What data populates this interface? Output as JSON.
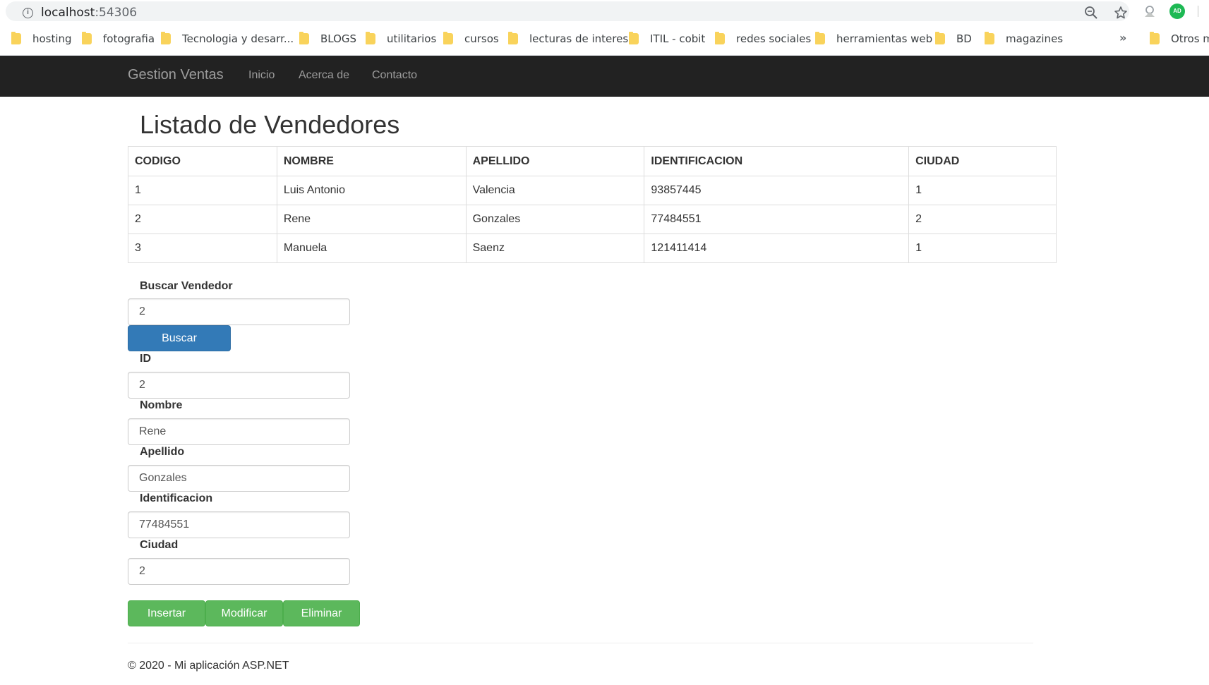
{
  "browser": {
    "url_host": "localhost",
    "url_port": ":54306",
    "avatar_initials": "AD",
    "bookmarks": [
      {
        "label": "hosting"
      },
      {
        "label": "fotografia"
      },
      {
        "label": "Tecnologia y desarr..."
      },
      {
        "label": "BLOGS"
      },
      {
        "label": "utilitarios"
      },
      {
        "label": "cursos"
      },
      {
        "label": "lecturas de interes"
      },
      {
        "label": "ITIL - cobit"
      },
      {
        "label": "redes sociales"
      },
      {
        "label": "herramientas web"
      },
      {
        "label": "BD"
      },
      {
        "label": "magazines"
      },
      {
        "label": "Otros ma"
      }
    ],
    "overflow_label": "»"
  },
  "navbar": {
    "brand": "Gestion Ventas",
    "links": [
      "Inicio",
      "Acerca de",
      "Contacto"
    ]
  },
  "page": {
    "title": "Listado de Vendedores"
  },
  "table": {
    "headers": [
      "CODIGO",
      "NOMBRE",
      "APELLIDO",
      "IDENTIFICACION",
      "CIUDAD"
    ],
    "rows": [
      [
        "1",
        "Luis Antonio",
        "Valencia",
        "93857445",
        "1"
      ],
      [
        "2",
        "Rene",
        "Gonzales",
        "77484551",
        "2"
      ],
      [
        "3",
        "Manuela",
        "Saenz",
        "121411414",
        "1"
      ]
    ]
  },
  "search": {
    "label": "Buscar Vendedor",
    "value": "2",
    "button": "Buscar"
  },
  "form": {
    "id_label": "ID",
    "id_value": "2",
    "nombre_label": "Nombre",
    "nombre_value": "Rene",
    "apellido_label": "Apellido",
    "apellido_value": "Gonzales",
    "identificacion_label": "Identificacion",
    "identificacion_value": "77484551",
    "ciudad_label": "Ciudad",
    "ciudad_value": "2"
  },
  "actions": {
    "insert": "Insertar",
    "update": "Modificar",
    "delete": "Eliminar"
  },
  "footer": {
    "text": "© 2020 - Mi aplicación ASP.NET"
  },
  "colors": {
    "navbar_bg": "#222222",
    "primary": "#337ab7",
    "success": "#5cb85c",
    "folder": "#f9d35b"
  }
}
